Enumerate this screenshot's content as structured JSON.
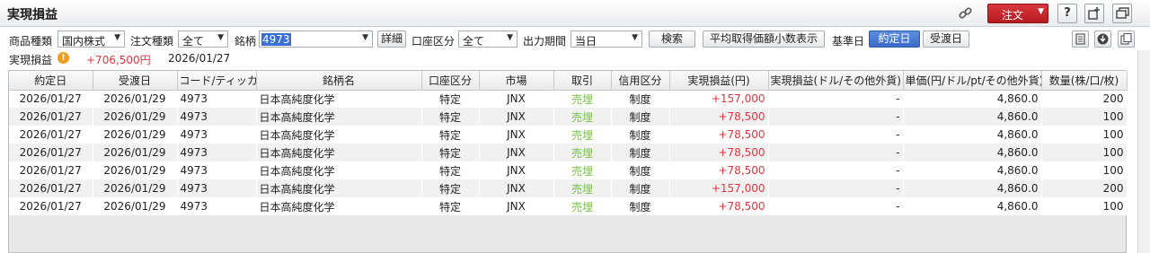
{
  "window": {
    "title": "実現損益",
    "order_button_label": "注文",
    "icons": [
      "link-icon",
      "help-icon",
      "new-window-icon",
      "restore-icon"
    ]
  },
  "filters": {
    "product_type_label": "商品種類",
    "product_type_value": "国内株式",
    "order_type_label": "注文種類",
    "order_type_value": "全て",
    "symbol_label": "銘柄",
    "symbol_value": "4973",
    "detail_button": "詳細",
    "account_type_label": "口座区分",
    "account_type_value": "全て",
    "period_label": "出力期間",
    "period_value": "当日",
    "search_button": "検索",
    "avg_price_button": "平均取得価額小数表示",
    "base_date_label": "基準日",
    "trade_date_button": "約定日",
    "settlement_date_button": "受渡日"
  },
  "summary": {
    "label": "実現損益",
    "value": "+706,500円",
    "date": "2026/01/27"
  },
  "table": {
    "columns": [
      "約定日",
      "受渡日",
      "コード/ティッカー",
      "銘柄名",
      "口座区分",
      "市場",
      "取引",
      "信用区分",
      "実現損益(円)",
      "実現損益(ドル/その他外貨)",
      "単価(円/ドル/pt/その他外貨)",
      "数量(株/口/枚)"
    ],
    "rows": [
      {
        "trade_date": "2026/01/27",
        "settle_date": "2026/01/29",
        "code": "4973",
        "name": "日本高純度化学",
        "account": "特定",
        "market": "JNX",
        "trade": "売埋",
        "margin": "制度",
        "pl_jpy": "+157,000",
        "pl_fx": "-",
        "price": "4,860.0",
        "qty": "200"
      },
      {
        "trade_date": "2026/01/27",
        "settle_date": "2026/01/29",
        "code": "4973",
        "name": "日本高純度化学",
        "account": "特定",
        "market": "JNX",
        "trade": "売埋",
        "margin": "制度",
        "pl_jpy": "+78,500",
        "pl_fx": "-",
        "price": "4,860.0",
        "qty": "100"
      },
      {
        "trade_date": "2026/01/27",
        "settle_date": "2026/01/29",
        "code": "4973",
        "name": "日本高純度化学",
        "account": "特定",
        "market": "JNX",
        "trade": "売埋",
        "margin": "制度",
        "pl_jpy": "+78,500",
        "pl_fx": "-",
        "price": "4,860.0",
        "qty": "100"
      },
      {
        "trade_date": "2026/01/27",
        "settle_date": "2026/01/29",
        "code": "4973",
        "name": "日本高純度化学",
        "account": "特定",
        "market": "JNX",
        "trade": "売埋",
        "margin": "制度",
        "pl_jpy": "+78,500",
        "pl_fx": "-",
        "price": "4,860.0",
        "qty": "100"
      },
      {
        "trade_date": "2026/01/27",
        "settle_date": "2026/01/29",
        "code": "4973",
        "name": "日本高純度化学",
        "account": "特定",
        "market": "JNX",
        "trade": "売埋",
        "margin": "制度",
        "pl_jpy": "+78,500",
        "pl_fx": "-",
        "price": "4,860.0",
        "qty": "100"
      },
      {
        "trade_date": "2026/01/27",
        "settle_date": "2026/01/29",
        "code": "4973",
        "name": "日本高純度化学",
        "account": "特定",
        "market": "JNX",
        "trade": "売埋",
        "margin": "制度",
        "pl_jpy": "+157,000",
        "pl_fx": "-",
        "price": "4,860.0",
        "qty": "200"
      },
      {
        "trade_date": "2026/01/27",
        "settle_date": "2026/01/29",
        "code": "4973",
        "name": "日本高純度化学",
        "account": "特定",
        "market": "JNX",
        "trade": "売埋",
        "margin": "制度",
        "pl_jpy": "+78,500",
        "pl_fx": "-",
        "price": "4,860.0",
        "qty": "100"
      }
    ]
  },
  "colors": {
    "profit": "#e8343b",
    "sell": "#7ac143",
    "accent": "#3a6cc8",
    "order_button": "#c8262c"
  }
}
